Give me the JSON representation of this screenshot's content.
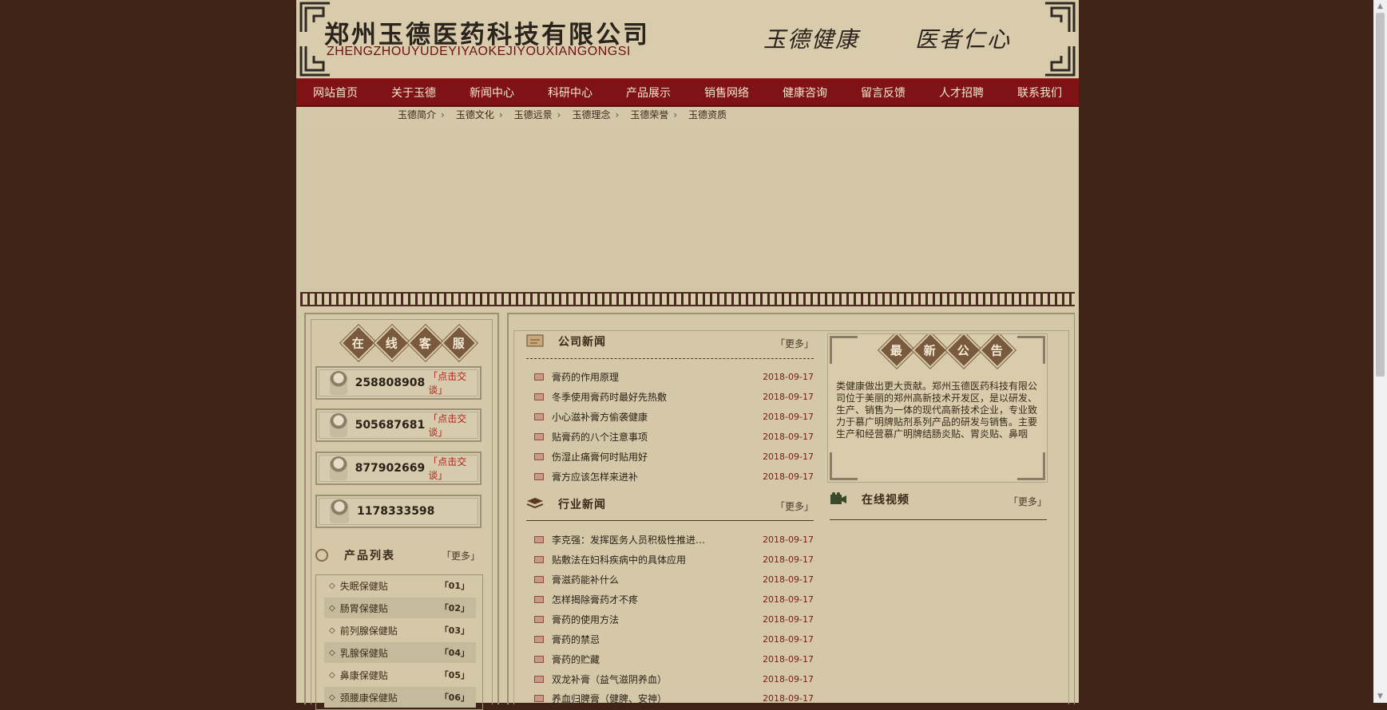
{
  "header": {
    "company_cn": "郑州玉德医药科技有限公司",
    "company_en": "ZHENGZHOUYUDEYIYAOKEJIYOUXIANGONGSI",
    "slogan_1": "玉德健康",
    "slogan_2": "医者仁心"
  },
  "nav": [
    "网站首页",
    "关于玉德",
    "新闻中心",
    "科研中心",
    "产品展示",
    "销售网络",
    "健康咨询",
    "留言反馈",
    "人才招聘",
    "联系我们"
  ],
  "subnav": [
    "玉德简介",
    "玉德文化",
    "玉德远景",
    "玉德理念",
    "玉德荣誉",
    "玉德资质"
  ],
  "online_service": {
    "chars": [
      "在",
      "线",
      "客",
      "服"
    ],
    "qq": [
      {
        "number": "258808908",
        "chat": "「点击交谈」"
      },
      {
        "number": "505687681",
        "chat": "「点击交谈」"
      },
      {
        "number": "877902669",
        "chat": "「点击交谈」"
      },
      {
        "number": "1178333598",
        "chat": ""
      }
    ]
  },
  "product_list": {
    "title": "产品列表",
    "more": "「更多」",
    "items": [
      {
        "name": "失眠保健贴",
        "idx": "「01」"
      },
      {
        "name": "肠胃保健贴",
        "idx": "「02」"
      },
      {
        "name": "前列腺保健贴",
        "idx": "「03」"
      },
      {
        "name": "乳腺保健贴",
        "idx": "「04」"
      },
      {
        "name": "鼻康保健贴",
        "idx": "「05」"
      },
      {
        "name": "颈腰康保健贴",
        "idx": "「06」"
      }
    ]
  },
  "company_news": {
    "title": "公司新闻",
    "more": "「更多」",
    "items": [
      {
        "title": "膏药的作用原理",
        "date": "2018-09-17"
      },
      {
        "title": "冬季使用膏药时最好先热敷",
        "date": "2018-09-17"
      },
      {
        "title": "小心滋补膏方偷袭健康",
        "date": "2018-09-17"
      },
      {
        "title": "贴膏药的八个注意事项",
        "date": "2018-09-17"
      },
      {
        "title": "伤湿止痛膏何时贴用好",
        "date": "2018-09-17"
      },
      {
        "title": "膏方应该怎样来进补",
        "date": "2018-09-17"
      }
    ]
  },
  "industry_news": {
    "title": "行业新闻",
    "more": "「更多」",
    "items": [
      {
        "title": "李克强：发挥医务人员积极性推进…",
        "date": "2018-09-17"
      },
      {
        "title": "贴敷法在妇科疾病中的具体应用",
        "date": "2018-09-17"
      },
      {
        "title": "膏滋药能补什么",
        "date": "2018-09-17"
      },
      {
        "title": "怎样揭除膏药才不疼",
        "date": "2018-09-17"
      },
      {
        "title": "膏药的使用方法",
        "date": "2018-09-17"
      },
      {
        "title": "膏药的禁忌",
        "date": "2018-09-17"
      },
      {
        "title": "膏药的贮藏",
        "date": "2018-09-17"
      },
      {
        "title": "双龙补膏（益气滋阴养血）",
        "date": "2018-09-17"
      },
      {
        "title": "养血归脾膏（健脾、安神）",
        "date": "2018-09-17"
      }
    ]
  },
  "notice": {
    "chars": [
      "最",
      "新",
      "公",
      "告"
    ],
    "text": "类健康做出更大贡献。郑州玉德医药科技有限公司位于美丽的郑州高新技术开发区，是以研发、生产、销售为一体的现代高新技术企业，专业致力于慕广明牌贴剂系列产品的研发与销售。主要生产和经营慕广明牌结肠炎贴、胃炎贴、鼻咽"
  },
  "video": {
    "title": "在线视频",
    "more": "「更多」"
  },
  "colors": {
    "background": "#3f2317",
    "page": "#d4c8a8",
    "nav": "#7e1214",
    "accent_red": "#b0221c"
  }
}
